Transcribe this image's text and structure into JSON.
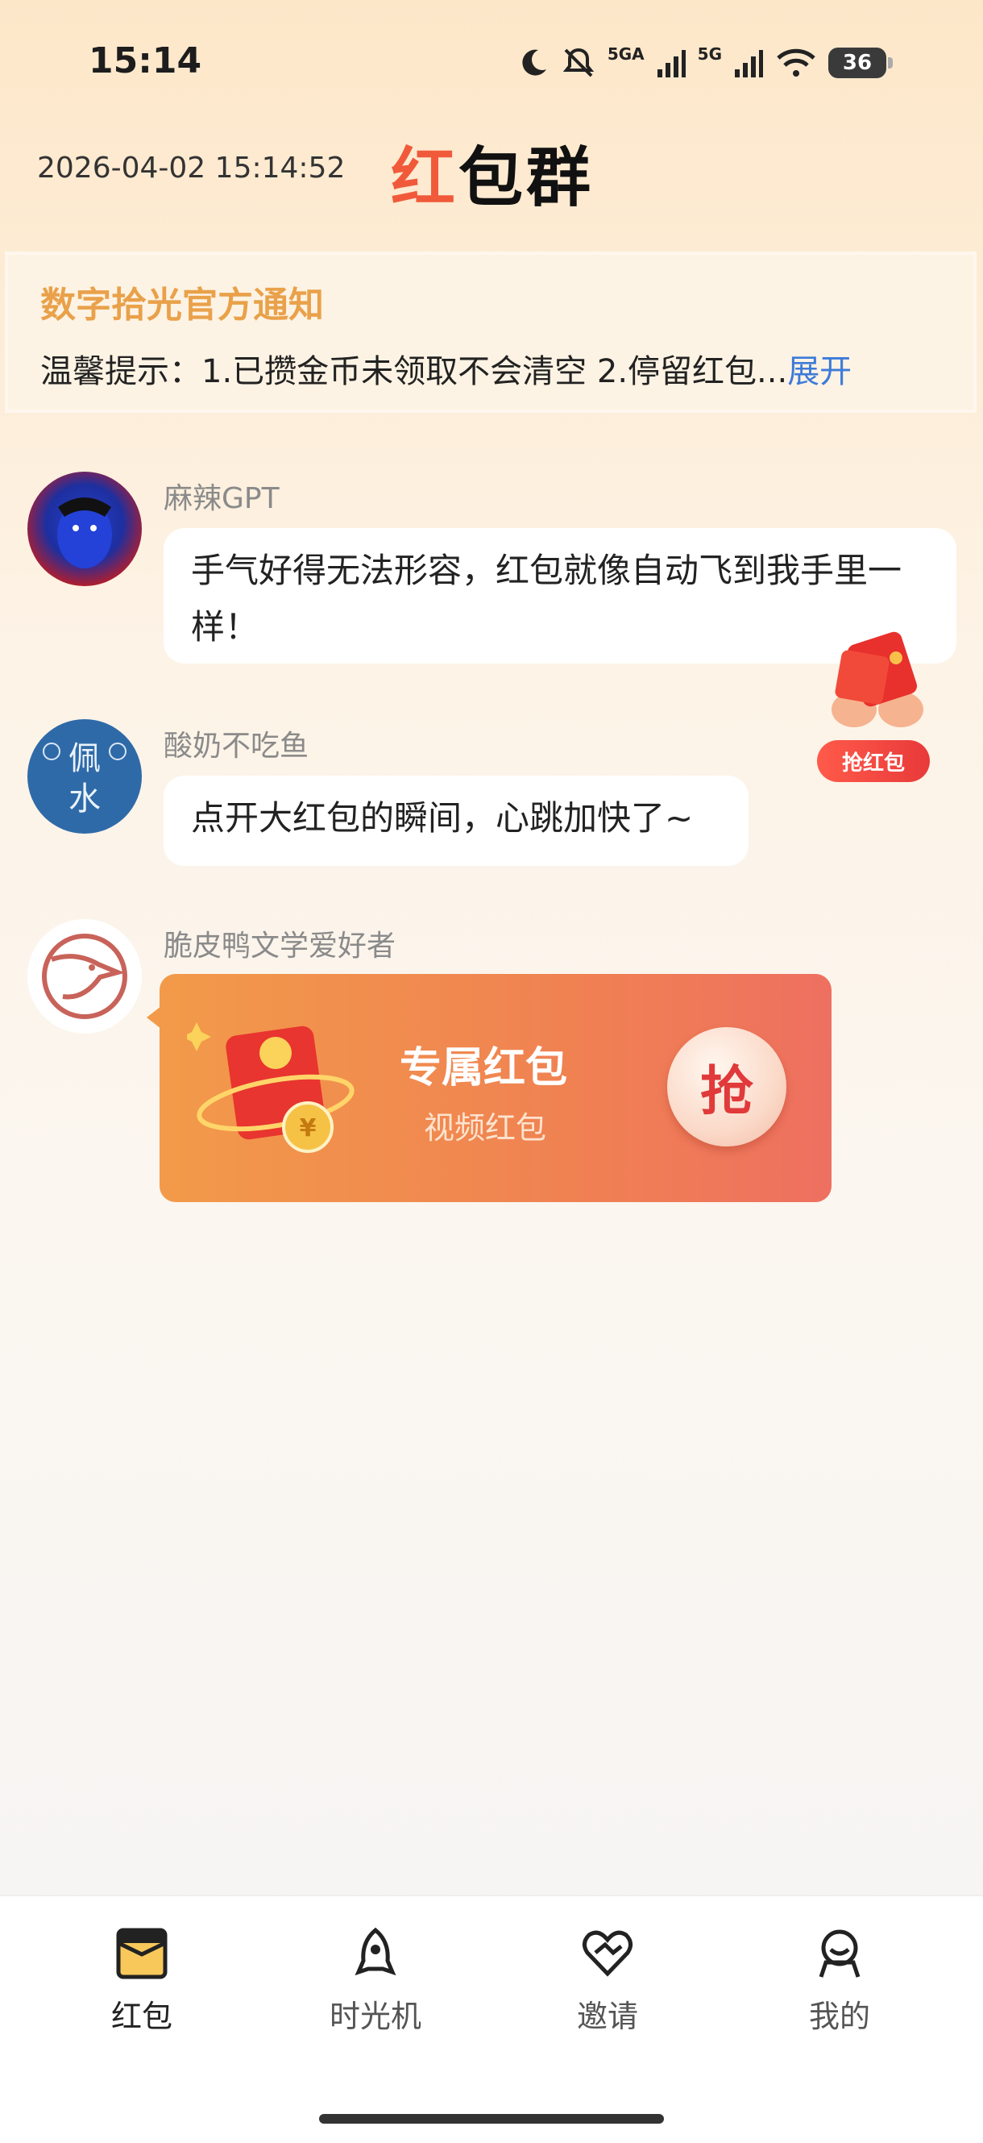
{
  "status": {
    "time": "15:14",
    "battery": "36",
    "net1": "5GA",
    "net2": "5G"
  },
  "header": {
    "datetime": "2026-04-02 15:14:52",
    "title_a": "红",
    "title_b": "包群"
  },
  "notice": {
    "title": "数字拾光官方通知",
    "text": "温馨提示：1.已攒金币未领取不会清空 2.停留红包...",
    "more": "展开"
  },
  "messages": [
    {
      "user": "麻辣GPT",
      "text": "手气好得无法形容，红包就像自动飞到我手里一样！"
    },
    {
      "user": "酸奶不吃鱼",
      "text": "点开大红包的瞬间，心跳加快了~"
    },
    {
      "user": "脆皮鸭文学爱好者"
    }
  ],
  "avatar2_text": {
    "top": "佩",
    "bottom": "水"
  },
  "floating": {
    "label": "抢红包"
  },
  "redpack": {
    "title": "专属红包",
    "subtitle": "视频红包",
    "grab": "抢"
  },
  "tabs": [
    {
      "label": "红包",
      "icon": "red-envelope-icon"
    },
    {
      "label": "时光机",
      "icon": "rocket-icon"
    },
    {
      "label": "邀请",
      "icon": "heart-icon"
    },
    {
      "label": "我的",
      "icon": "user-icon"
    }
  ],
  "colors": {
    "accent": "#f05a3a",
    "notice_title": "#e9a14a",
    "link": "#3d7bd9"
  }
}
